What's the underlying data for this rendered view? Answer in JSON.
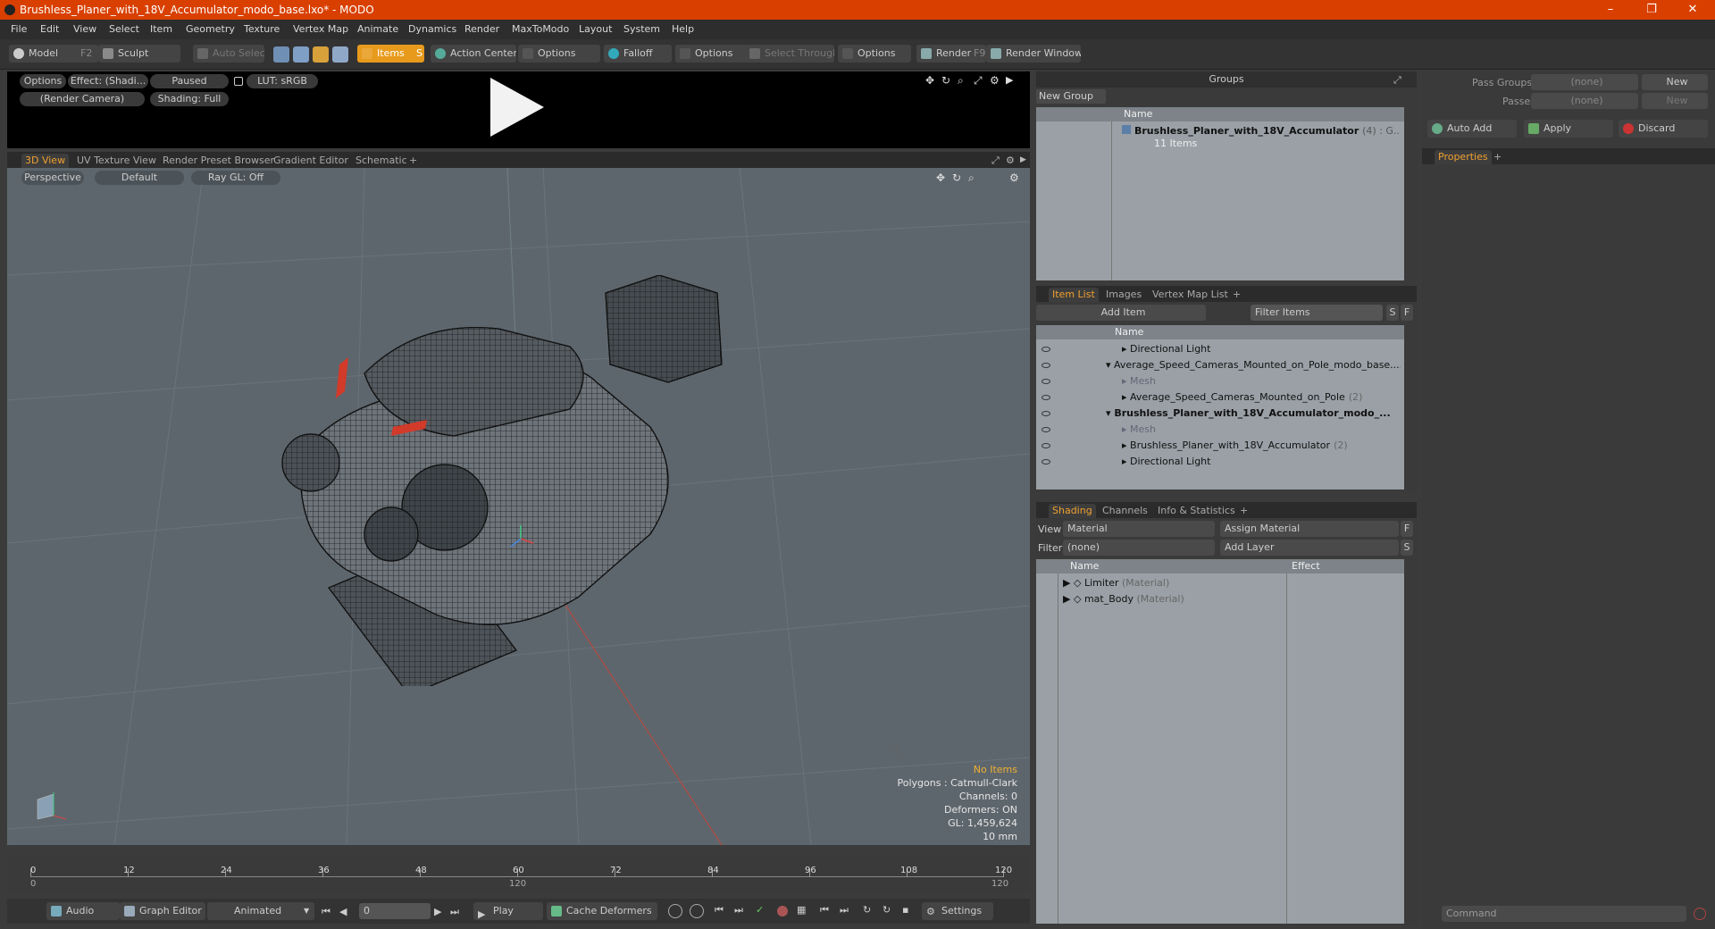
{
  "window": {
    "title": "Brushless_Planer_with_18V_Accumulator_modo_base.lxo* - MODO",
    "minimize": "–",
    "maximize": "❐",
    "close": "✕"
  },
  "menu": [
    "File",
    "Edit",
    "View",
    "Select",
    "Item",
    "Geometry",
    "Texture",
    "Vertex Map",
    "Animate",
    "Dynamics",
    "Render",
    "MaxToModo",
    "Layout",
    "System",
    "Help"
  ],
  "toolbar": {
    "model": "Model",
    "model_key": "F2",
    "sculpt": "Sculpt",
    "auto_select": "Auto Select",
    "items": "Items",
    "items_key": "S",
    "action_center": "Action Center",
    "options1": "Options",
    "falloff": "Falloff",
    "options2": "Options",
    "select_through": "Select Through",
    "options3": "Options",
    "render": "Render",
    "render_key": "F9",
    "render_window": "Render Window"
  },
  "preview": {
    "options": "Options",
    "effect": "Effect: (Shadi...",
    "paused": "Paused",
    "lut": "LUT: sRGB",
    "camera": "(Render Camera)",
    "shading": "Shading: Full"
  },
  "viewport_tabs": [
    "3D View",
    "UV Texture View",
    "Render Preset Browser",
    "Gradient Editor",
    "Schematic",
    "+"
  ],
  "viewport": {
    "perspective": "Perspective",
    "default": "Default",
    "raygl": "Ray GL: Off",
    "axis_label": "-Z"
  },
  "status": {
    "no_items": "No Items",
    "polygons": "Polygons : Catmull-Clark",
    "channels": "Channels: 0",
    "deformers": "Deformers: ON",
    "gl": "GL: 1,459,624",
    "unit": "10 mm"
  },
  "timeline": {
    "ticks": [
      "0",
      "12",
      "24",
      "36",
      "48",
      "60",
      "72",
      "84",
      "96",
      "108",
      "120"
    ],
    "start_mark": "0",
    "end_mark": "120",
    "end_mark2": "120"
  },
  "bottombar": {
    "audio": "Audio",
    "graph_editor": "Graph Editor",
    "animated": "Animated",
    "frame": "0",
    "play": "Play",
    "cache": "Cache Deformers",
    "settings": "Settings"
  },
  "groups": {
    "title": "Groups",
    "new_group": "New Group",
    "col_name": "Name",
    "item_name": "Brushless_Planer_with_18V_Accumulator",
    "item_suffix": "(4) : G...",
    "item_count": "11 Items"
  },
  "itemlist": {
    "tabs": [
      "Item List",
      "Images",
      "Vertex Map List",
      "+"
    ],
    "add_item": "Add Item",
    "filter": "Filter Items",
    "s": "S",
    "f": "F",
    "col_name": "Name",
    "rows": [
      {
        "label": "Directional Light",
        "indent": 1,
        "bold": false,
        "dim": false,
        "suffix": ""
      },
      {
        "label": "Average_Speed_Cameras_Mounted_on_Pole_modo_base....",
        "indent": 0,
        "bold": false,
        "dim": false,
        "suffix": ""
      },
      {
        "label": "Mesh",
        "indent": 1,
        "bold": false,
        "dim": true,
        "suffix": ""
      },
      {
        "label": "Average_Speed_Cameras_Mounted_on_Pole",
        "indent": 1,
        "bold": false,
        "dim": false,
        "suffix": "(2)"
      },
      {
        "label": "Brushless_Planer_with_18V_Accumulator_modo_...",
        "indent": 0,
        "bold": true,
        "dim": false,
        "suffix": ""
      },
      {
        "label": "Mesh",
        "indent": 1,
        "bold": false,
        "dim": true,
        "suffix": ""
      },
      {
        "label": "Brushless_Planer_with_18V_Accumulator",
        "indent": 1,
        "bold": false,
        "dim": false,
        "suffix": "(2)"
      },
      {
        "label": "Directional Light",
        "indent": 1,
        "bold": false,
        "dim": false,
        "suffix": ""
      }
    ]
  },
  "shading": {
    "tabs": [
      "Shading",
      "Channels",
      "Info & Statistics",
      "+"
    ],
    "view_label": "View",
    "view_value": "Material",
    "assign": "Assign Material",
    "f": "F",
    "filter_label": "Filter",
    "filter_value": "(none)",
    "add_layer": "Add Layer",
    "s": "S",
    "col_name": "Name",
    "col_effect": "Effect",
    "rows": [
      {
        "name": "Limiter",
        "type": "(Material)"
      },
      {
        "name": "mat_Body",
        "type": "(Material)"
      }
    ]
  },
  "passes": {
    "pass_groups": "Pass Groups",
    "pass_value": "(none)",
    "new": "New",
    "passes": "Passes",
    "passes_value": "(none)",
    "new2": "New",
    "auto_add": "Auto Add",
    "apply": "Apply",
    "discard": "Discard",
    "properties": "Properties",
    "plus": "+",
    "command": "Command"
  }
}
